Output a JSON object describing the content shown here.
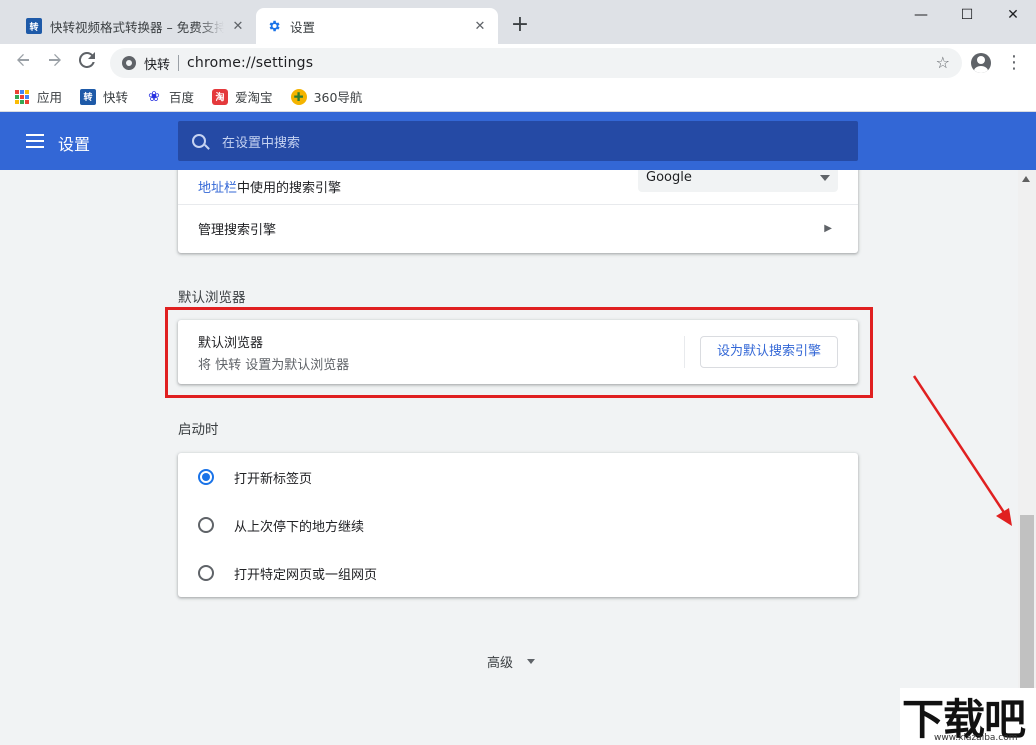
{
  "tabs": [
    {
      "title": "快转视频格式转换器 – 免费支持高",
      "favicon": "zhuan-favicon",
      "favicon_text": "转"
    },
    {
      "title": "设置",
      "favicon": "gear-icon"
    }
  ],
  "new_tab_icon": "plus-icon",
  "window_controls": {
    "minimize": "—",
    "maximize": "☐",
    "close": "✕"
  },
  "omnibox": {
    "site": "快转",
    "url": "chrome://settings"
  },
  "bookmarks": [
    {
      "label": "应用",
      "icon": "apps-grid-icon"
    },
    {
      "label": "快转",
      "icon": "zhuan-icon",
      "icon_text": "转"
    },
    {
      "label": "百度",
      "icon": "baidu-paw-icon",
      "icon_text": "❀"
    },
    {
      "label": "爱淘宝",
      "icon": "taobao-icon",
      "icon_text": "淘"
    },
    {
      "label": "360导航",
      "icon": "360-icon",
      "icon_text": "✚"
    }
  ],
  "settings": {
    "title": "设置",
    "search_placeholder": "在设置中搜索"
  },
  "search_engine": {
    "address_bar_link": "地址栏",
    "address_bar_rest": "中使用的搜索引擎",
    "selected_engine": "Google",
    "manage_label": "管理搜索引擎"
  },
  "default_browser": {
    "section_title": "默认浏览器",
    "row_title": "默认浏览器",
    "row_subtitle": "将 快转 设置为默认浏览器",
    "button_label": "设为默认搜索引擎"
  },
  "startup": {
    "section_title": "启动时",
    "options": [
      {
        "label": "打开新标签页",
        "checked": true
      },
      {
        "label": "从上次停下的地方继续",
        "checked": false
      },
      {
        "label": "打开特定网页或一组网页",
        "checked": false
      }
    ]
  },
  "advanced_label": "高级",
  "annotation_color": "#e02020",
  "brand_color": "#3367d6",
  "watermark": {
    "text": "下载吧",
    "url": "www.xiazaiba.com"
  }
}
